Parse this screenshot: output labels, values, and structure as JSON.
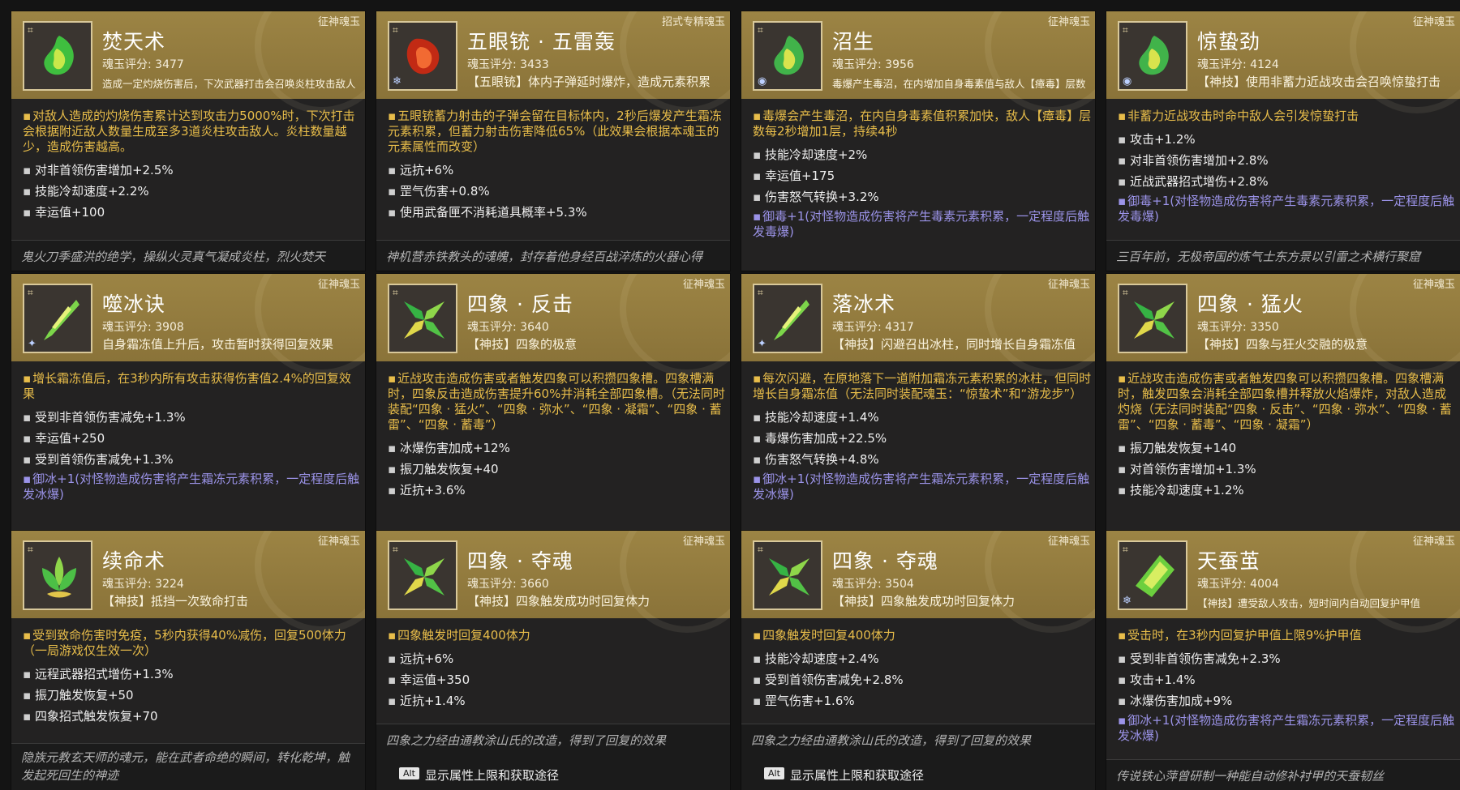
{
  "cards": [
    {
      "tag": "征神魂玉",
      "title": "焚天术",
      "score": "魂玉评分: 3477",
      "subtitle": "造成一定灼烧伤害后，下次武器打击会召唤炎柱攻击敌人",
      "icon": "green-flame-jade-icon",
      "primary": "对敌人造成的灼烧伤害累计达到攻击力5000%时，下次打击会根据附近敌人数量生成至多3道炎柱攻击敌人。炎柱数量越少，造成伤害越高。",
      "stats": [
        "对非首领伤害增加+2.5%",
        "技能冷却速度+2.2%",
        "幸运值+100"
      ],
      "bonus": "",
      "flavor": "鬼火刀季盛洪的绝学，操纵火灵真气凝成炎柱，烈火焚天"
    },
    {
      "tag": "招式专精魂玉",
      "title": "五眼铳 · 五雷轰",
      "score": "魂玉评分: 3433",
      "subtitle": "【五眼铳】体内子弹延时爆炸，造成元素积累",
      "icon": "red-jade-icon",
      "primary": "五眼铳蓄力射击的子弹会留在目标体内，2秒后爆发产生霜冻元素积累，但蓄力射击伤害降低65%（此效果会根据本魂玉的元素属性而改变）",
      "stats": [
        "远抗+6%",
        "罡气伤害+0.8%",
        "使用武备匣不消耗道具概率+5.3%"
      ],
      "bonus": "",
      "flavor": "神机营赤铁教头的魂魄，封存着他身经百战淬炼的火器心得"
    },
    {
      "tag": "征神魂玉",
      "title": "沼生",
      "score": "魂玉评分: 3956",
      "subtitle": "毒爆产生毒沼，在内增加自身毒素值与敌人【瘴毒】层数",
      "icon": "green-serpent-jade-icon",
      "primary": "毒爆会产生毒沼，在内自身毒素值积累加快，敌人【瘴毒】层数每2秒增加1层，持续4秒",
      "stats": [
        "技能冷却速度+2%",
        "幸运值+175",
        "伤害怒气转换+3.2%"
      ],
      "bonus": "御毒+1(对怪物造成伤害将产生毒素元素积累，一定程度后触发毒爆)",
      "flavor": ""
    },
    {
      "tag": "征神魂玉",
      "title": "惊蛰劲",
      "score": "魂玉评分: 4124",
      "subtitle": "【神技】使用非蓄力近战攻击会召唤惊蛰打击",
      "icon": "green-serpent-jade-icon",
      "primary": "非蓄力近战攻击时命中敌人会引发惊蛰打击",
      "stats": [
        "攻击+1.2%",
        "对非首领伤害增加+2.8%",
        "近战武器招式增伤+2.8%"
      ],
      "bonus": "御毒+1(对怪物造成伤害将产生毒素元素积累，一定程度后触发毒爆)",
      "flavor": "三百年前，无极帝国的炼气士东方景以引雷之术横行聚窟"
    },
    {
      "tag": "征神魂玉",
      "title": "噬冰诀",
      "score": "魂玉评分: 3908",
      "subtitle": "自身霜冻值上升后，攻击暂时获得回复效果",
      "icon": "ice-blade-jade-icon",
      "primary": "增长霜冻值后，在3秒内所有攻击获得伤害值2.4%的回复效果",
      "stats": [
        "受到非首领伤害减免+1.3%",
        "幸运值+250",
        "受到首领伤害减免+1.3%"
      ],
      "bonus": "御冰+1(对怪物造成伤害将产生霜冻元素积累，一定程度后触发冰爆)",
      "flavor": ""
    },
    {
      "tag": "征神魂玉",
      "title": "四象 · 反击",
      "score": "魂玉评分: 3640",
      "subtitle": "【神技】四象的极意",
      "icon": "four-symbols-jade-icon",
      "primary": "近战攻击造成伤害或者触发四象可以积攒四象槽。四象槽满时，四象反击造成伤害提升60%并消耗全部四象槽。（无法同时装配“四象 · 猛火”、“四象 · 弥水”、“四象 · 凝霜”、“四象 · 蓄雷”、“四象 · 蓄毒”）",
      "stats": [
        "冰爆伤害加成+12%",
        "振刀触发恢复+40",
        "近抗+3.6%"
      ],
      "bonus": "",
      "flavor": ""
    },
    {
      "tag": "征神魂玉",
      "title": "落冰术",
      "score": "魂玉评分: 4317",
      "subtitle": "【神技】闪避召出冰柱，同时增长自身霜冻值",
      "icon": "ice-blade-jade-icon",
      "primary": "每次闪避，在原地落下一道附加霜冻元素积累的冰柱，但同时增长自身霜冻值（无法同时装配魂玉：“惊蛰术”和“游龙步”）",
      "stats": [
        "技能冷却速度+1.4%",
        "毒爆伤害加成+22.5%",
        "伤害怒气转换+4.8%"
      ],
      "bonus": "御冰+1(对怪物造成伤害将产生霜冻元素积累，一定程度后触发冰爆)",
      "flavor": ""
    },
    {
      "tag": "征神魂玉",
      "title": "四象 · 猛火",
      "score": "魂玉评分: 3350",
      "subtitle": "【神技】四象与狂火交融的极意",
      "icon": "four-symbols-jade-icon",
      "primary": "近战攻击造成伤害或者触发四象可以积攒四象槽。四象槽满时，触发四象会消耗全部四象槽并释放火焰爆炸，对敌人造成灼烧（无法同时装配“四象 · 反击”、“四象 · 弥水”、“四象 · 蓄雷”、“四象 · 蓄毒”、“四象 · 凝霜”）",
      "stats": [
        "振刀触发恢复+140",
        "对首领伤害增加+1.3%",
        "技能冷却速度+1.2%"
      ],
      "bonus": "",
      "flavor": ""
    },
    {
      "tag": "征神魂玉",
      "title": "续命术",
      "score": "魂玉评分: 3224",
      "subtitle": "【神技】抵挡一次致命打击",
      "icon": "lotus-jade-icon",
      "primary": "受到致命伤害时免疫，5秒内获得40%减伤，回复500体力（一局游戏仅生效一次）",
      "stats": [
        "远程武器招式增伤+1.3%",
        "振刀触发恢复+50",
        "四象招式触发恢复+70"
      ],
      "bonus": "",
      "flavor": "隐族元教玄天师的魂元，能在武者命绝的瞬间，转化乾坤，触发起死回生的神迹"
    },
    {
      "tag": "征神魂玉",
      "title": "四象 · 夺魂",
      "score": "魂玉评分: 3660",
      "subtitle": "【神技】四象触发成功时回复体力",
      "icon": "four-symbols-jade-icon",
      "primary": "四象触发时回复400体力",
      "stats": [
        "远抗+6%",
        "幸运值+350",
        "近抗+1.4%"
      ],
      "bonus": "",
      "flavor": "四象之力经由通教涂山氏的改造，得到了回复的效果",
      "alt_key": "Alt",
      "alt_text": "显示属性上限和获取途径"
    },
    {
      "tag": "征神魂玉",
      "title": "四象 · 夺魂",
      "score": "魂玉评分: 3504",
      "subtitle": "【神技】四象触发成功时回复体力",
      "icon": "four-symbols-jade-icon",
      "primary": "四象触发时回复400体力",
      "stats": [
        "技能冷却速度+2.4%",
        "受到首领伤害减免+2.8%",
        "罡气伤害+1.6%"
      ],
      "bonus": "",
      "flavor": "四象之力经由通教涂山氏的改造，得到了回复的效果",
      "alt_key": "Alt",
      "alt_text": "显示属性上限和获取途径"
    },
    {
      "tag": "征神魂玉",
      "title": "天蚕茧",
      "score": "魂玉评分: 4004",
      "subtitle": "【神技】遭受敌人攻击，短时间内自动回复护甲值",
      "icon": "cocoon-jade-icon",
      "primary": "受击时，在3秒内回复护甲值上限9%护甲值",
      "stats": [
        "受到非首领伤害减免+2.3%",
        "攻击+1.4%",
        "冰爆伤害加成+9%"
      ],
      "bonus": "御冰+1(对怪物造成伤害将产生霜冻元素积累，一定程度后触发冰爆)",
      "flavor": "传说铁心萍曾研制一种能自动修补衬甲的天蚕韧丝"
    }
  ],
  "colors": {
    "header_gold": "#9c8444",
    "primary_text": "#e8bd4a",
    "bonus_text": "#9b93e8"
  }
}
